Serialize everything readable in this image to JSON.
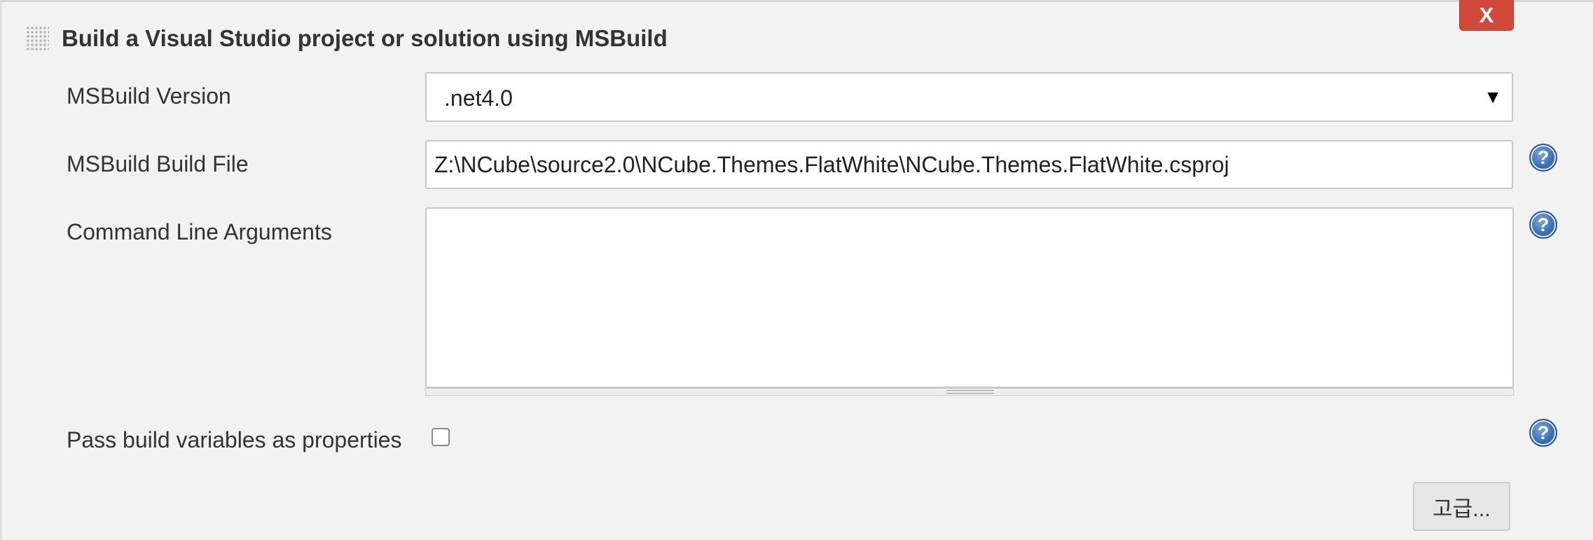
{
  "section": {
    "title": "Build a Visual Studio project or solution using MSBuild",
    "close_label": "X"
  },
  "fields": {
    "msbuild_version": {
      "label": "MSBuild Version",
      "selected": ".net4.0",
      "arrow": "▼"
    },
    "build_file": {
      "label": "MSBuild Build File",
      "value": "Z:\\NCube\\source2.0\\NCube.Themes.FlatWhite\\NCube.Themes.FlatWhite.csproj"
    },
    "command_line_args": {
      "label": "Command Line Arguments",
      "value": ""
    },
    "pass_build_vars": {
      "label": "Pass build variables as properties",
      "checked": false
    }
  },
  "help_icon_glyph": "?",
  "advanced_button_label": "고급...",
  "icons": [
    "drag-handle-icon",
    "close-icon",
    "help-icon",
    "dropdown-arrow-icon"
  ],
  "colors": {
    "background": "#f2f2f2",
    "close_button": "#d24939",
    "help_icon": "#3a6fb7",
    "input_border": "#c9c9c9"
  }
}
